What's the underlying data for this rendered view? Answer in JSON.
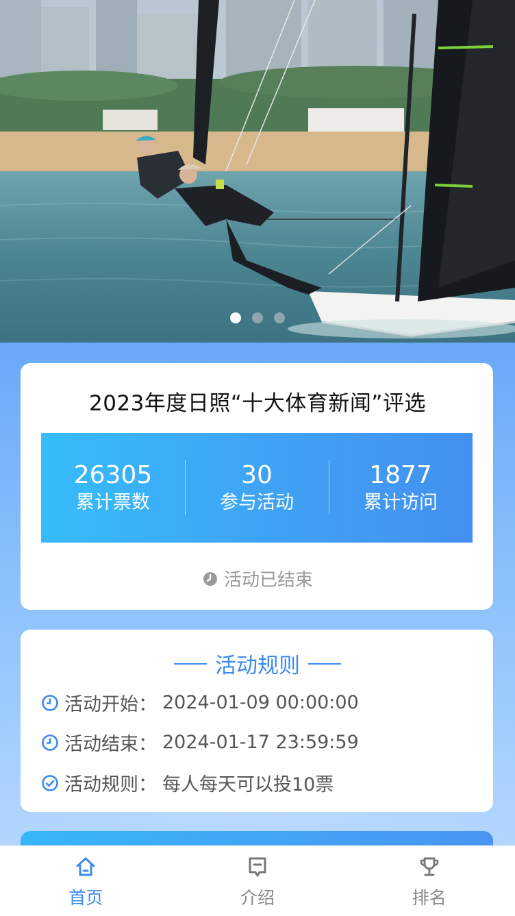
{
  "banner": {
    "image": "sailing-skiff-photo",
    "dots_total": 3,
    "active_dot": 1
  },
  "event": {
    "title": "2023年度日照“十大体育新闻”评选",
    "stats": [
      {
        "value": "26305",
        "label": "累计票数"
      },
      {
        "value": "30",
        "label": "参与活动"
      },
      {
        "value": "1877",
        "label": "累计访问"
      }
    ],
    "status_icon": "clock-icon",
    "status": "活动已结束"
  },
  "rules": {
    "heading": "活动规则",
    "start_label": "活动开始：",
    "start_value": "2024-01-09 00:00:00",
    "end_label": "活动结束：",
    "end_value": "2024-01-17 23:59:59",
    "rule_label": "活动规则：",
    "rule_value": "每人每天可以投10票"
  },
  "tabbar": {
    "items": [
      {
        "label": "首页",
        "icon": "home-icon",
        "active": true
      },
      {
        "label": "介绍",
        "icon": "message-icon",
        "active": false
      },
      {
        "label": "排名",
        "icon": "trophy-icon",
        "active": false
      }
    ]
  },
  "colors": {
    "accent": "#3b8af0",
    "stats_gradient_start": "#36bcfb",
    "stats_gradient_end": "#4390f0",
    "muted_text": "#999999"
  }
}
